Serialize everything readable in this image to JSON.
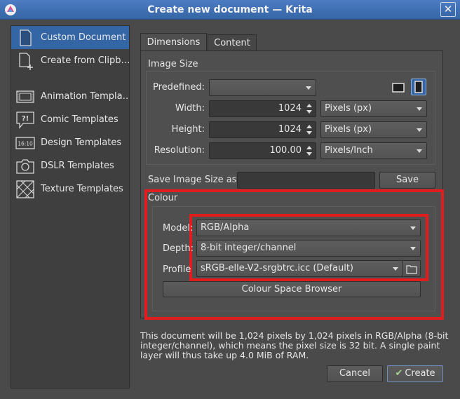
{
  "window": {
    "title": "Create new document — Krita",
    "close_symbol": "✕"
  },
  "sidebar": {
    "items": [
      {
        "label": "Custom Document",
        "icon": "document-icon"
      },
      {
        "label": "Create from Clipb…",
        "icon": "clipboard-new-icon"
      },
      {
        "label": "Animation Templa…",
        "icon": "film-icon"
      },
      {
        "label": "Comic Templates",
        "icon": "speech-bubble-icon"
      },
      {
        "label": "Design Templates",
        "icon": "design-screen-icon"
      },
      {
        "label": "DSLR Templates",
        "icon": "camera-icon"
      },
      {
        "label": "Texture Templates",
        "icon": "texture-icon"
      }
    ],
    "design_icon_text": "16:10",
    "comic_icon_text": "?!"
  },
  "tabs": [
    {
      "label": "Dimensions",
      "active": true
    },
    {
      "label": "Content",
      "active": false
    }
  ],
  "image_size": {
    "group_label": "Image Size",
    "predefined_label": "Predefined:",
    "predefined_value": "",
    "width_label": "Width:",
    "width_value": "1024",
    "width_unit": "Pixels (px)",
    "height_label": "Height:",
    "height_value": "1024",
    "height_unit": "Pixels (px)",
    "resolution_label": "Resolution:",
    "resolution_value": "100.00",
    "resolution_unit": "Pixels/Inch",
    "orientation": [
      "landscape-icon",
      "portrait-icon"
    ],
    "selected_orientation": "portrait-icon"
  },
  "save_size": {
    "label": "Save Image Size as:",
    "value": "",
    "button": "Save"
  },
  "colour": {
    "group_label": "Colour",
    "model_label": "Model:",
    "model_value": "RGB/Alpha",
    "depth_label": "Depth:",
    "depth_value": "8-bit integer/channel",
    "profile_label": "Profile",
    "profile_value": "sRGB-elle-V2-srgbtrc.icc (Default)",
    "browser_button": "Colour Space Browser"
  },
  "description": "This document will be 1,024 pixels by 1,024 pixels in RGB/Alpha (8-bit integer/channel), which means the pixel size is 32 bit. A single paint layer will thus take up 4.0 MiB of RAM.",
  "footer": {
    "cancel": "Cancel",
    "create": "Create"
  },
  "colors": {
    "accent": "#3465a4",
    "highlight": "#e11d1d",
    "background": "#4a4a4a"
  }
}
